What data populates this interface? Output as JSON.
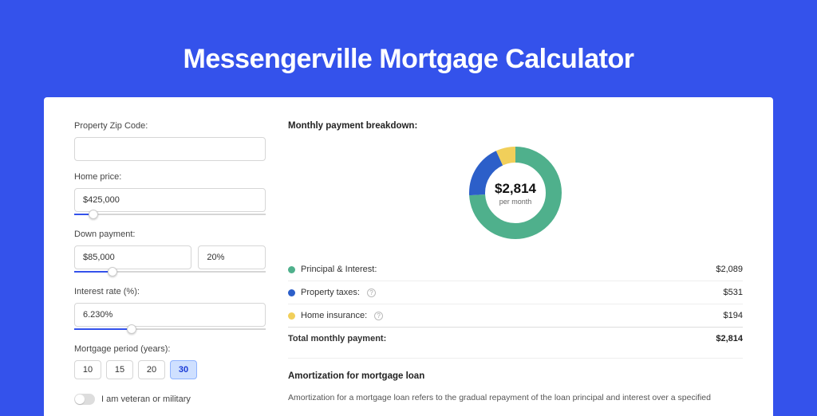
{
  "title": "Messengerville Mortgage Calculator",
  "form": {
    "zip_label": "Property Zip Code:",
    "zip_value": "",
    "home_price_label": "Home price:",
    "home_price_value": "$425,000",
    "home_price_slider_pct": 10,
    "down_payment_label": "Down payment:",
    "down_payment_value": "$85,000",
    "down_payment_pct": "20%",
    "down_payment_slider_pct": 20,
    "interest_label": "Interest rate (%):",
    "interest_value": "6.230%",
    "interest_slider_pct": 30,
    "period_label": "Mortgage period (years):",
    "periods": [
      "10",
      "15",
      "20",
      "30"
    ],
    "period_active": "30",
    "veteran_label": "I am veteran or military"
  },
  "breakdown": {
    "title": "Monthly payment breakdown:",
    "total_value": "$2,814",
    "total_sub": "per month",
    "items": [
      {
        "label": "Principal & Interest:",
        "value": "$2,089",
        "color": "#4fb08c",
        "pct": 74,
        "help": false
      },
      {
        "label": "Property taxes:",
        "value": "$531",
        "color": "#2c5fc9",
        "pct": 19,
        "help": true
      },
      {
        "label": "Home insurance:",
        "value": "$194",
        "color": "#f1cf5a",
        "pct": 7,
        "help": true
      }
    ],
    "total_row_label": "Total monthly payment:",
    "total_row_value": "$2,814"
  },
  "amort": {
    "title": "Amortization for mortgage loan",
    "text": "Amortization for a mortgage loan refers to the gradual repayment of the loan principal and interest over a specified"
  },
  "chart_data": {
    "type": "pie",
    "title": "Monthly payment breakdown",
    "series": [
      {
        "name": "Principal & Interest",
        "value": 2089
      },
      {
        "name": "Property taxes",
        "value": 531
      },
      {
        "name": "Home insurance",
        "value": 194
      }
    ],
    "total": 2814,
    "unit": "USD per month"
  }
}
